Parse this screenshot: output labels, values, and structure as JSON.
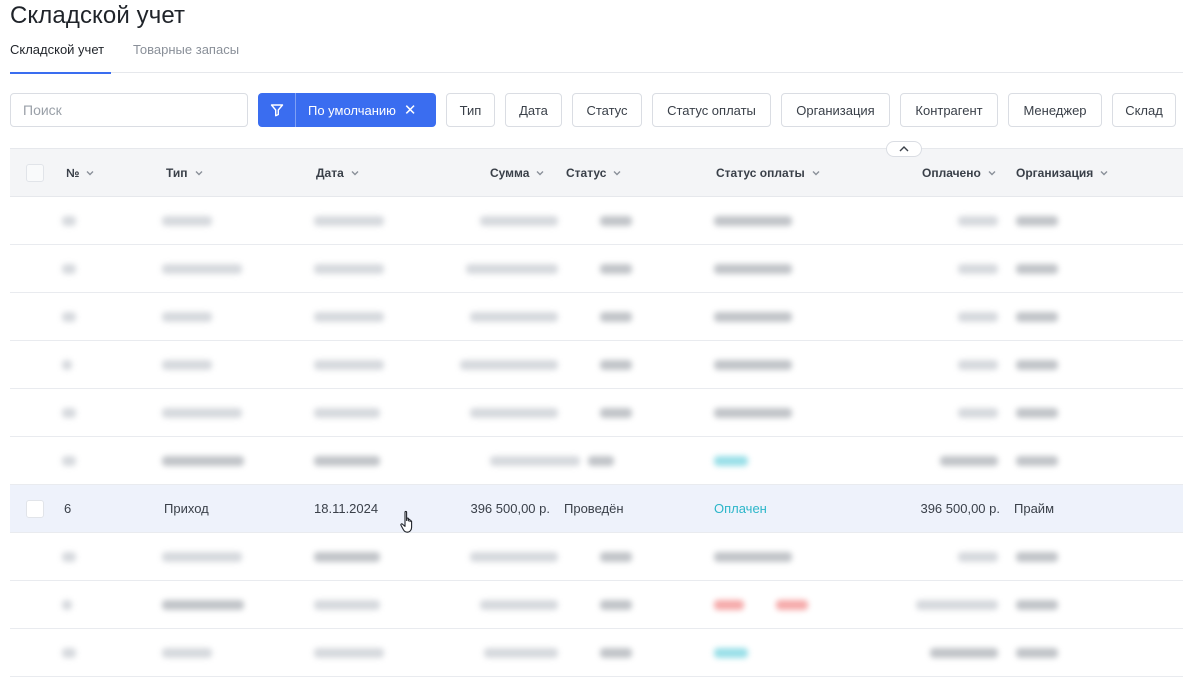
{
  "page": {
    "title": "Складской учет"
  },
  "tabs": [
    {
      "label": "Складской учет",
      "active": true
    },
    {
      "label": "Товарные запасы",
      "active": false
    }
  ],
  "toolbar": {
    "search_placeholder": "Поиск",
    "preset_label": "По умолчанию",
    "filters": [
      "Тип",
      "Дата",
      "Статус",
      "Статус оплаты",
      "Организация",
      "Контрагент",
      "Менеджер",
      "Склад"
    ]
  },
  "table": {
    "columns": [
      "№",
      "Тип",
      "Дата",
      "Сумма",
      "Статус",
      "Статус оплаты",
      "Оплачено",
      "Организация"
    ],
    "highlighted_row": {
      "num": "6",
      "type": "Приход",
      "date": "18.11.2024",
      "sum": "396 500,00 р.",
      "status": "Проведён",
      "pay_status": "Оплачен",
      "paid": "396 500,00 р.",
      "org": "Прайм"
    }
  },
  "colors": {
    "accent": "#3a6df0",
    "paid": "#2bb6c9",
    "row_highlight": "#eef2fb"
  }
}
